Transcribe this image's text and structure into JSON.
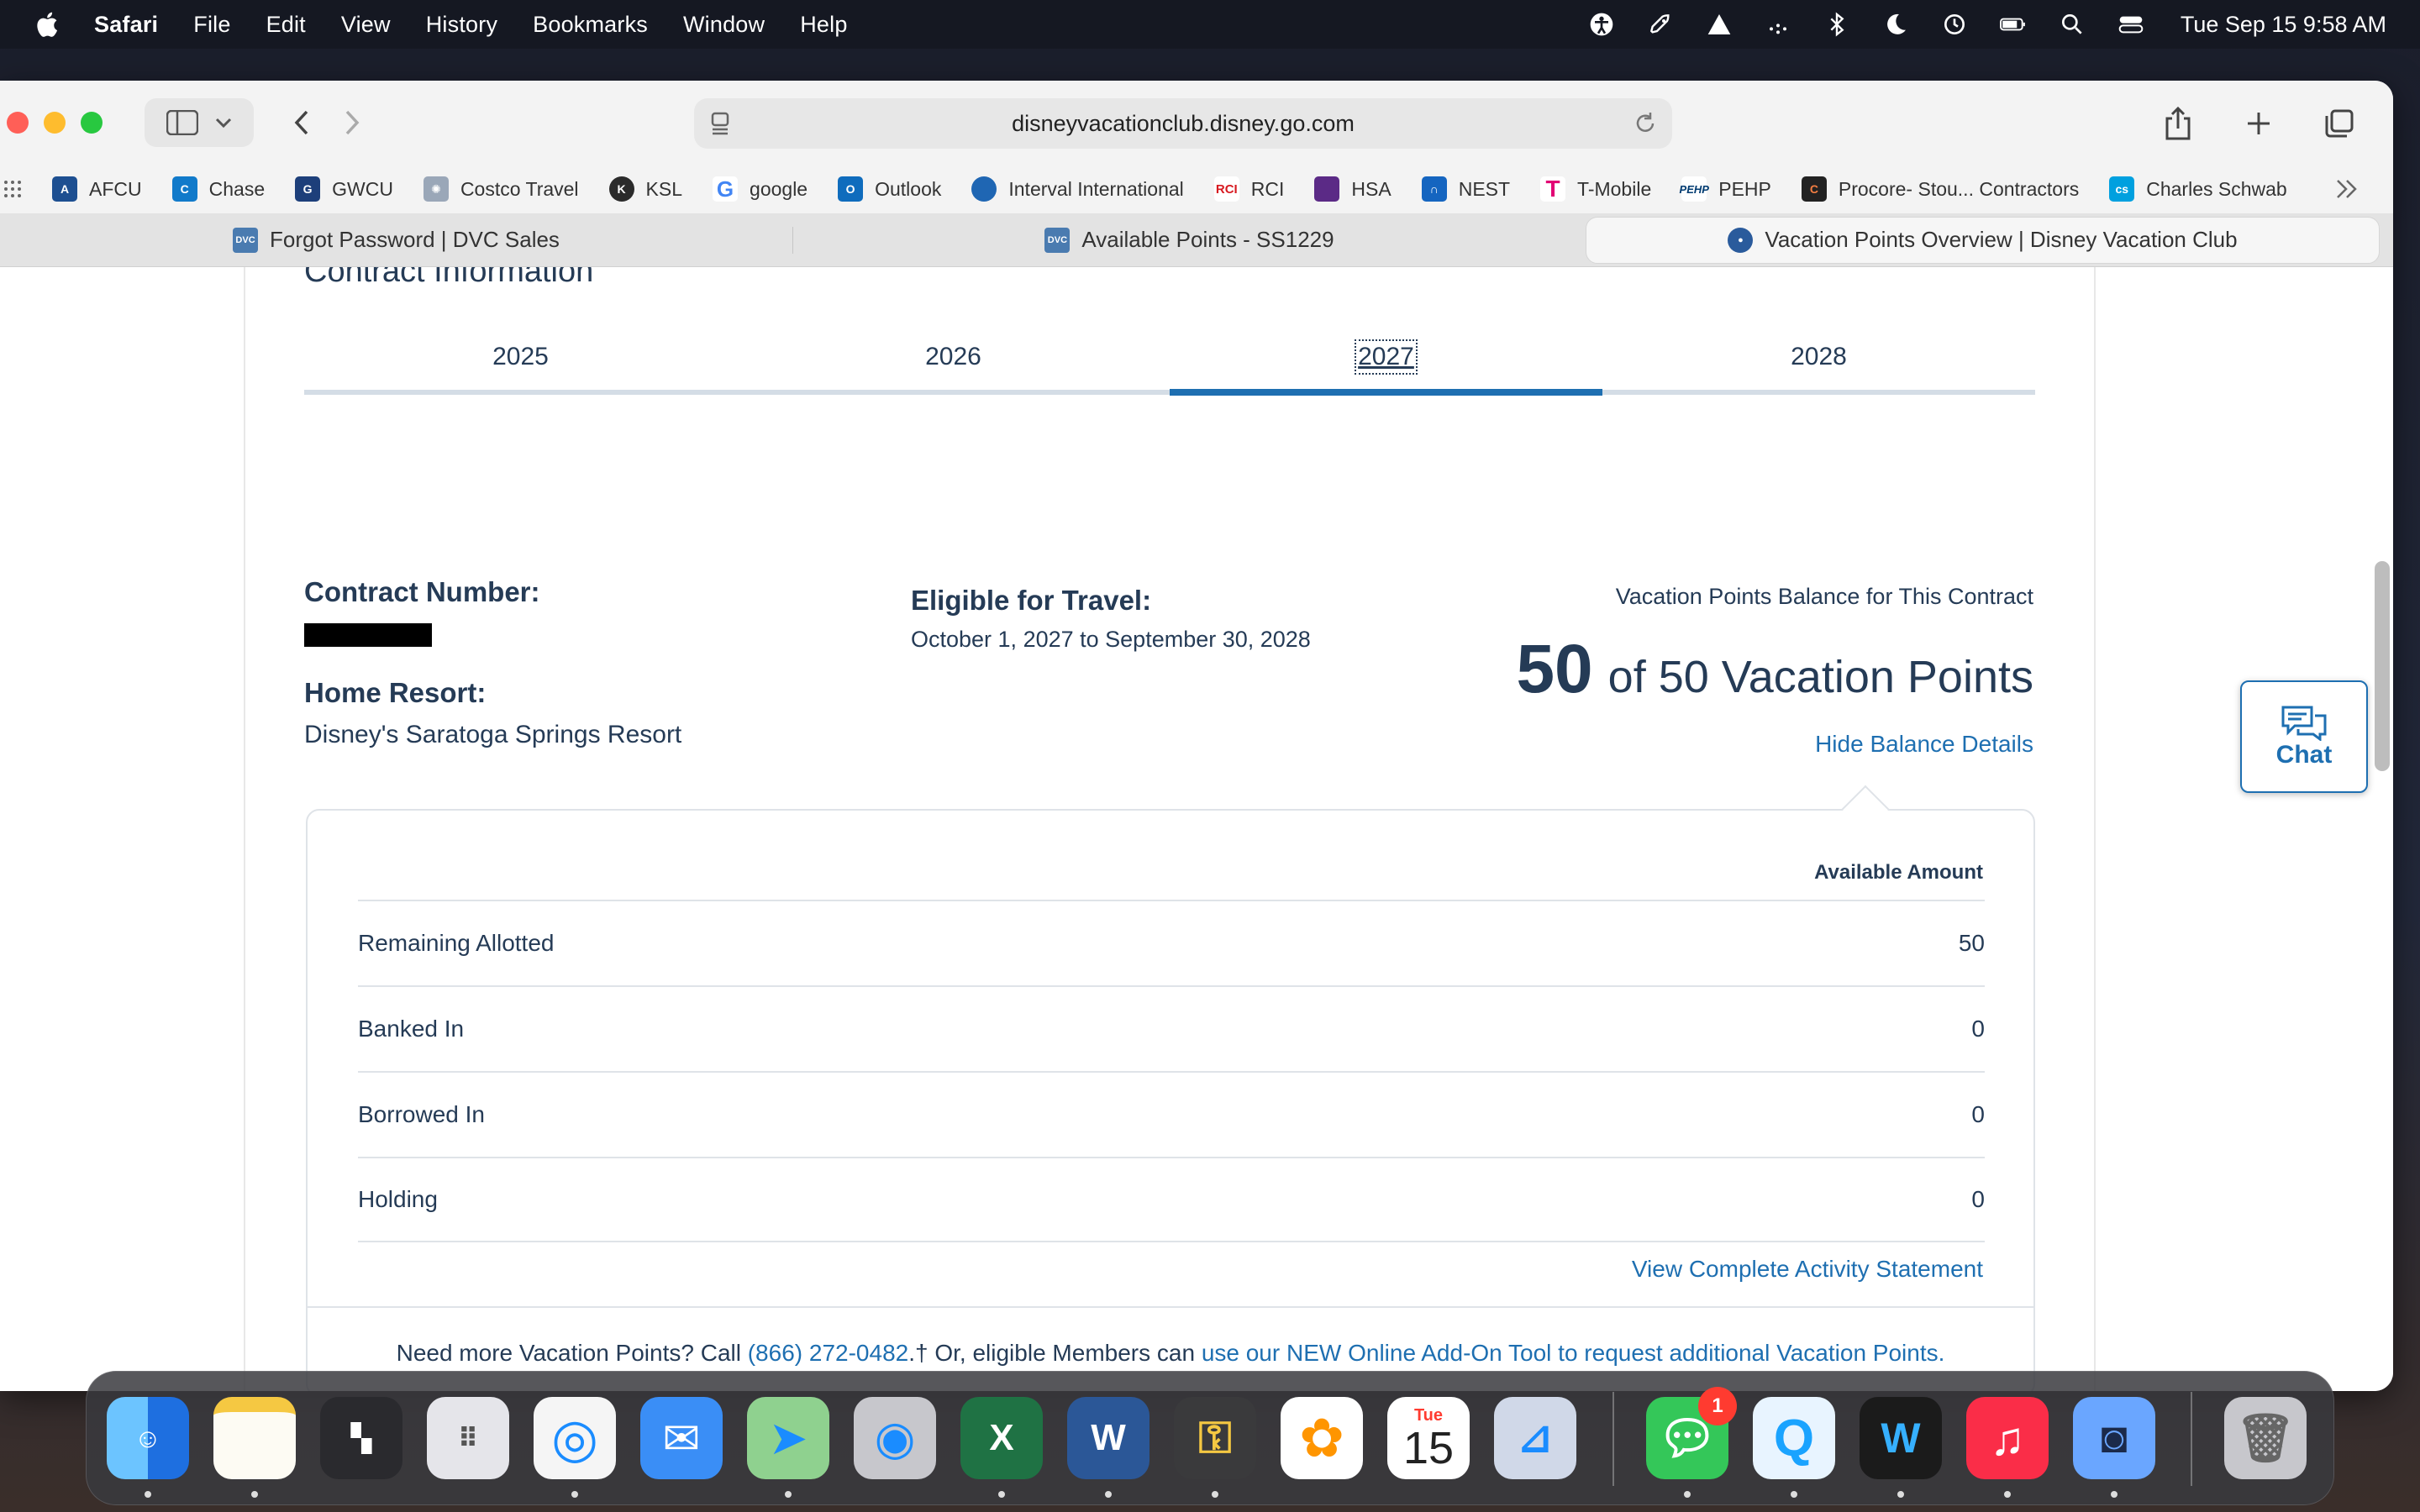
{
  "menubar": {
    "app": "Safari",
    "items": [
      "File",
      "Edit",
      "View",
      "History",
      "Bookmarks",
      "Window",
      "Help"
    ],
    "clock": "Tue Sep 15  9:58 AM"
  },
  "browser": {
    "url": "disneyvacationclub.disney.go.com",
    "bookmarks": [
      {
        "label": "AFCU",
        "color": "#1d4f91"
      },
      {
        "label": "Chase",
        "color": "#117aca"
      },
      {
        "label": "GWCU",
        "color": "#1d3f7a"
      },
      {
        "label": "Costco Travel",
        "color": "#9aa7b8"
      },
      {
        "label": "KSL",
        "color": "#2b2b2b"
      },
      {
        "label": "google",
        "color": "#4285f4"
      },
      {
        "label": "Outlook",
        "color": "#0f6cbd"
      },
      {
        "label": "Interval International",
        "color": "#1f66b3"
      },
      {
        "label": "RCI",
        "color": "#d71920"
      },
      {
        "label": "HSA",
        "color": "#5b2a86"
      },
      {
        "label": "NEST",
        "color": "#1565c0"
      },
      {
        "label": "T-Mobile",
        "color": "#e20074"
      },
      {
        "label": "PEHP",
        "color": "#003b71"
      },
      {
        "label": "Procore- Stou... Contractors",
        "color": "#f47e42"
      },
      {
        "label": "Charles Schwab",
        "color": "#00a0df"
      }
    ],
    "tabs": [
      {
        "label": "Forgot Password | DVC Sales"
      },
      {
        "label": "Available Points - SS1229"
      },
      {
        "label": "Vacation Points Overview | Disney Vacation Club"
      }
    ]
  },
  "page": {
    "section_title": "Contract Information",
    "years": [
      "2025",
      "2026",
      "2027",
      "2028"
    ],
    "active_year": "2027",
    "contract_number_label": "Contract Number:",
    "home_resort_label": "Home Resort:",
    "home_resort": "Disney's Saratoga Springs Resort",
    "eligible_label": "Eligible for Travel:",
    "eligible_dates": "October 1, 2027 to September 30, 2028",
    "balance_title": "Vacation Points Balance for This Contract",
    "balance_current": "50",
    "balance_rest": "of 50 Vacation Points",
    "hide_link": "Hide Balance Details",
    "details": {
      "column_header": "Available Amount",
      "rows": [
        {
          "label": "Remaining Allotted",
          "value": "50"
        },
        {
          "label": "Banked In",
          "value": "0"
        },
        {
          "label": "Borrowed In",
          "value": "0"
        },
        {
          "label": "Holding",
          "value": "0"
        }
      ],
      "activity_link": "View Complete Activity Statement",
      "footer_text_1": "Need more Vacation Points? Call ",
      "footer_phone": "(866) 272-0482",
      "footer_text_2": ".† Or, eligible Members can ",
      "footer_link": "use our NEW Online Add-On Tool to request additional Vacation Points."
    },
    "chat_label": "Chat"
  },
  "dock": {
    "apps": [
      {
        "name": "finder",
        "color": "#1e90ff"
      },
      {
        "name": "notes",
        "color": "#f5d76e"
      },
      {
        "name": "stage-manager",
        "color": "#2a2a2e"
      },
      {
        "name": "launchpad",
        "color": "#8e8e93"
      },
      {
        "name": "safari",
        "color": "#1a8cff"
      },
      {
        "name": "mail",
        "color": "#3a8ef6"
      },
      {
        "name": "maps",
        "color": "#5ac85a"
      },
      {
        "name": "find-my",
        "color": "#8e8e93"
      },
      {
        "name": "excel",
        "color": "#1f7244"
      },
      {
        "name": "word",
        "color": "#2b5797"
      },
      {
        "name": "keychain",
        "color": "#3a3a3c"
      },
      {
        "name": "photos",
        "color": "#f2f2f2"
      },
      {
        "name": "calendar",
        "color": "#ffffff"
      },
      {
        "name": "preview",
        "color": "#d0d8e8"
      },
      {
        "name": "messages",
        "color": "#34c759"
      },
      {
        "name": "quicktime",
        "color": "#1aa3ff"
      },
      {
        "name": "webex",
        "color": "#1b1b1b"
      },
      {
        "name": "music",
        "color": "#fa2d48"
      },
      {
        "name": "migration",
        "color": "#6aa6ff"
      },
      {
        "name": "trash",
        "color": "#b0b0b0"
      }
    ],
    "messages_badge": "1",
    "calendar_day": "Tue",
    "calendar_date": "15"
  }
}
